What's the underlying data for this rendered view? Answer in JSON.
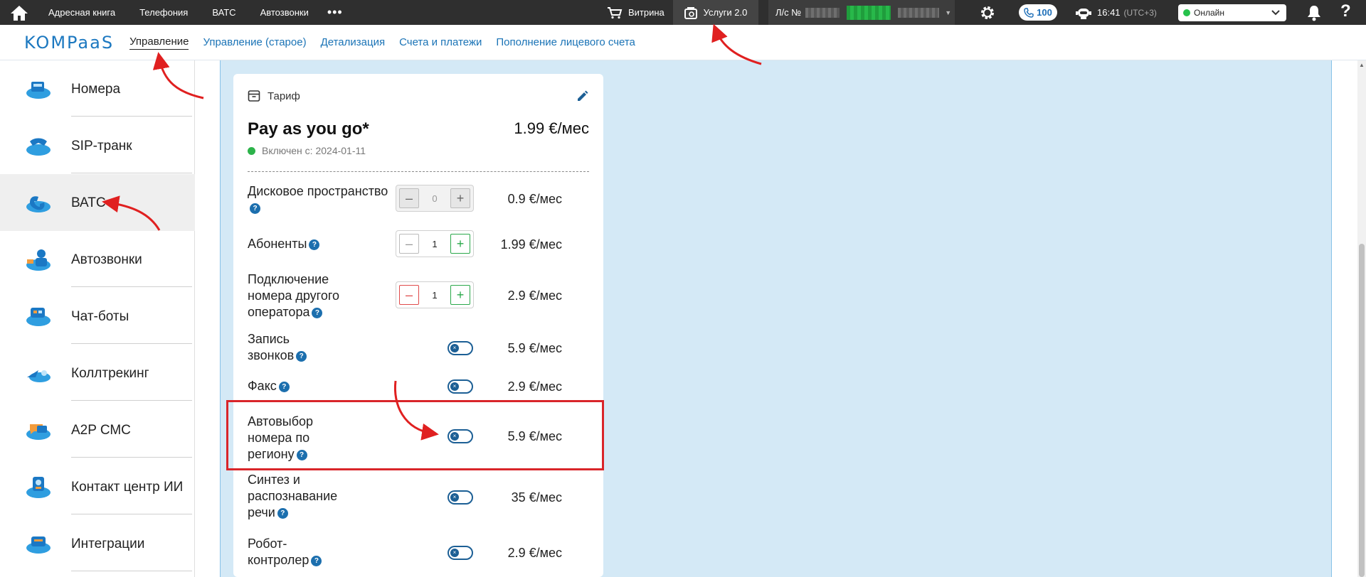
{
  "topbar": {
    "links": [
      "Адресная книга",
      "Телефония",
      "ВАТС",
      "Автозвонки"
    ],
    "more": "•••",
    "vitrina": "Витрина",
    "uslugi": "Услуги 2.0",
    "account_label": "Л/с №",
    "calls_count": "100",
    "time": "16:41",
    "timezone": "(UTC+3)",
    "status": "Онлайн",
    "help": "?"
  },
  "nav": {
    "logo": "KOMPaaS",
    "tabs": [
      "Управление",
      "Управление (старое)",
      "Детализация",
      "Счета и платежи",
      "Пополнение лицевого счета"
    ]
  },
  "sidebar": {
    "items": [
      "Номера",
      "SIP-транк",
      "ВАТС",
      "Автозвонки",
      "Чат-боты",
      "Коллтрекинг",
      "A2P СМС",
      "Контакт центр ИИ",
      "Интеграции"
    ],
    "active_index": 2
  },
  "card": {
    "header": "Тариф",
    "plan_name": "Pay as you go*",
    "plan_price": "1.99 €/мес",
    "enabled_since": "Включен с: 2024-01-11",
    "options": [
      {
        "name": "Дисковое пространство",
        "control": "stepper",
        "value": "0",
        "disabled": true,
        "price": "0.9 €/мес"
      },
      {
        "name": "Абоненты",
        "control": "stepper",
        "value": "1",
        "disabled": false,
        "price": "1.99 €/мес"
      },
      {
        "name": "Подключение номера другого оператора",
        "control": "stepper",
        "value": "1",
        "disabled": false,
        "price": "2.9 €/мес"
      },
      {
        "name": "Запись звонков",
        "control": "toggle",
        "price": "5.9 €/мес"
      },
      {
        "name": "Факс",
        "control": "toggle",
        "price": "2.9 €/мес"
      },
      {
        "name": "Автовыбор номера по региону",
        "control": "toggle",
        "price": "5.9 €/мес"
      },
      {
        "name": "Синтез и распознавание речи",
        "control": "toggle",
        "price": "35 €/мес"
      },
      {
        "name": "Робот-контролер",
        "control": "toggle",
        "price": "2.9 €/мес"
      }
    ]
  },
  "colors": {
    "topbar": "#2f2f2f",
    "accent_blue": "#1a73b6",
    "main_bg": "#d4e9f6",
    "highlight_red": "#d9252a",
    "online_green": "#27c24c"
  }
}
